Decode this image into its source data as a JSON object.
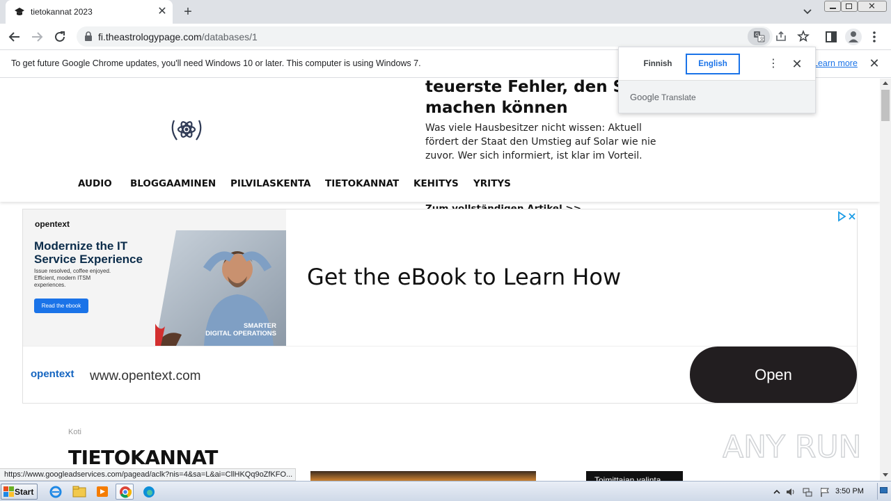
{
  "browser": {
    "tab_title": "tietokannat 2023",
    "url_host": "fi.theastrologypage.com",
    "url_path": "/databases/1"
  },
  "infobar": {
    "message": "To get future Google Chrome updates, you'll need Windows 10 or later. This computer is using Windows 7.",
    "link": "Learn more"
  },
  "translate": {
    "source_lang": "Finnish",
    "target_lang": "English",
    "footer_brand": "Google",
    "footer_product": "Translate"
  },
  "promo": {
    "headline_1": "teuerste Fehler, den Sie",
    "headline_2": "machen können",
    "body": "Was viele Hausbesitzer nicht wissen: Aktuell fördert der Staat den Umstieg auf Solar wie nie zuvor. Wer sich informiert, ist klar im Vorteil.",
    "read_more": "Zum vollständigen Artikel >>"
  },
  "nav": {
    "items": [
      "AUDIO",
      "BLOGGAAMINEN",
      "PILVILASKENTA",
      "TIETOKANNAT",
      "KEHITYS",
      "YRITYS"
    ]
  },
  "ad": {
    "image_brand": "opentext",
    "image_headline": "Modernize the IT Service Experience",
    "image_sub": "Issue resolved, coffee enjoyed. Efficient, modern ITSM experiences.",
    "image_button": "Read the ebook",
    "image_tag_1": "SMARTER",
    "image_tag_2": "DIGITAL OPERATIONS",
    "headline": "Get the eBook to Learn How",
    "brand": "opentext",
    "site": "www.opentext.com",
    "cta": "Open"
  },
  "content": {
    "breadcrumb": "Koti",
    "title": "TIETOKANNAT",
    "editor_badge": "Toimittajan valinta"
  },
  "status_url": "https://www.googleadservices.com/pagead/aclk?nis=4&sa=L&ai=CllHKQq9oZfKFO...",
  "taskbar": {
    "start": "Start",
    "clock": "3:50 PM"
  },
  "watermark": "ANY RUN",
  "colors": {
    "accent": "#1a73e8",
    "tabstrip": "#dee1e6",
    "open_button": "#221e20",
    "opentext_blue": "#1565c0"
  }
}
